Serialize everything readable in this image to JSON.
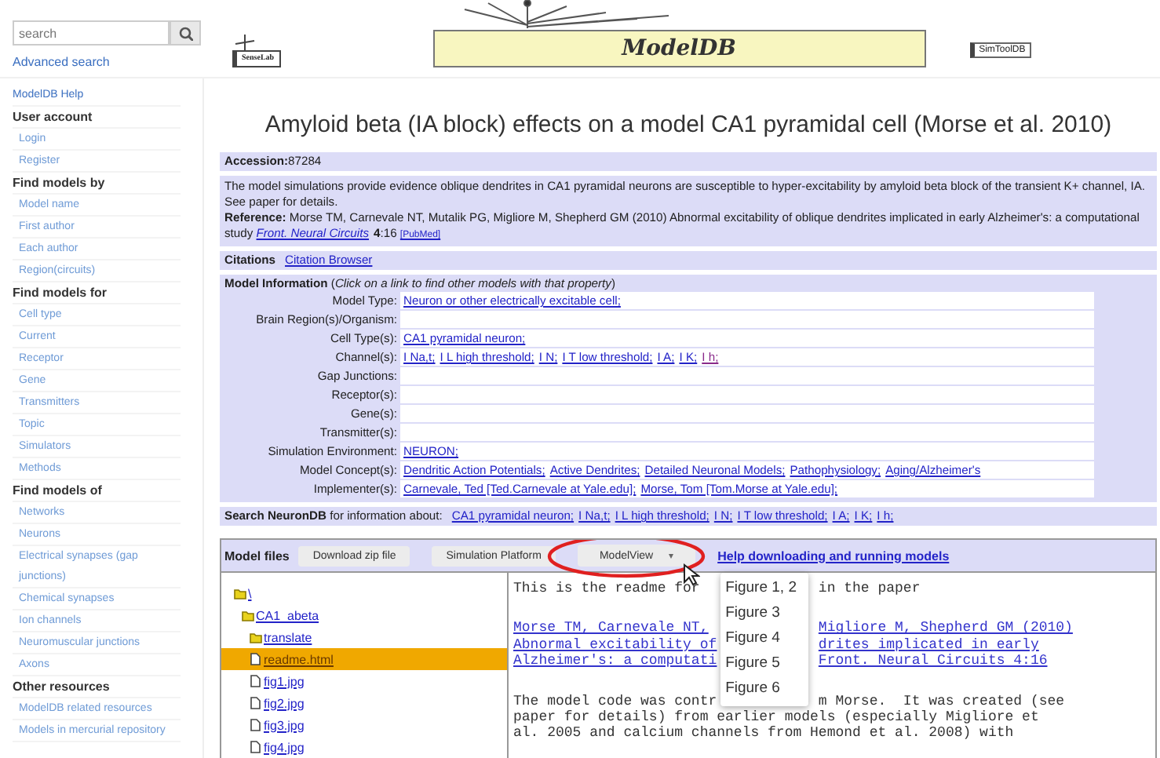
{
  "sidebar": {
    "search": {
      "placeholder": "search"
    },
    "advanced_search": "Advanced search",
    "items": [
      {
        "kind": "link",
        "label": "ModelDB Help"
      },
      {
        "kind": "heading",
        "label": "User account"
      },
      {
        "kind": "sublink",
        "label": "Login"
      },
      {
        "kind": "sublink",
        "label": "Register"
      },
      {
        "kind": "heading",
        "label": "Find models by"
      },
      {
        "kind": "sublink",
        "label": "Model name"
      },
      {
        "kind": "sublink",
        "label": "First author"
      },
      {
        "kind": "sublink",
        "label": "Each author"
      },
      {
        "kind": "sublink",
        "label": "Region(circuits)"
      },
      {
        "kind": "heading",
        "label": "Find models for"
      },
      {
        "kind": "sublink",
        "label": "Cell type"
      },
      {
        "kind": "sublink",
        "label": "Current"
      },
      {
        "kind": "sublink",
        "label": "Receptor"
      },
      {
        "kind": "sublink",
        "label": "Gene"
      },
      {
        "kind": "sublink",
        "label": "Transmitters"
      },
      {
        "kind": "sublink",
        "label": "Topic"
      },
      {
        "kind": "sublink",
        "label": "Simulators"
      },
      {
        "kind": "sublink",
        "label": "Methods"
      },
      {
        "kind": "heading",
        "label": "Find models of"
      },
      {
        "kind": "sublink",
        "label": "Networks"
      },
      {
        "kind": "sublink",
        "label": "Neurons"
      },
      {
        "kind": "sublink",
        "label": "Electrical synapses (gap junctions)"
      },
      {
        "kind": "sublink",
        "label": "Chemical synapses"
      },
      {
        "kind": "sublink",
        "label": "Ion channels"
      },
      {
        "kind": "sublink",
        "label": "Neuromuscular junctions"
      },
      {
        "kind": "sublink",
        "label": "Axons"
      },
      {
        "kind": "heading",
        "label": "Other resources"
      },
      {
        "kind": "sublink",
        "label": "ModelDB related resources"
      },
      {
        "kind": "sublink",
        "label": "Models in mercurial repository"
      }
    ]
  },
  "header": {
    "senselab": "SenseLab",
    "modeldb": "ModelDB",
    "simtooldb": "SimToolDB"
  },
  "title": "Amyloid beta (IA block) effects on a model CA1 pyramidal cell (Morse et al. 2010)",
  "accession": "**Accession:**87284",
  "description": "The model simulations provide evidence oblique dendrites in CA1 pyramidal neurons are susceptible to hyper-excitability by amyloid beta block of the transient K+ channel, IA. See paper for details.",
  "reference": {
    "text": "**Reference:** Morse TM, Carnevale NT, Mutalik PG, Migliore M, Shepherd GM (2010) Abnormal excitability of oblique dendrites implicated in early Alzheimer's: a computational study",
    "journal": "Front. Neural Circuits",
    "volume": "**4**:16",
    "pubmed": "[PubMed]"
  },
  "citations": {
    "label": "Citations",
    "link": "Citation Browser"
  },
  "model_information": {
    "heading": "**Model Information** (*Click on a link to find other models with that property*)",
    "rows": [
      {
        "label": "Model Type:",
        "links": [
          {
            "text": "Neuron or other electrically excitable cell;",
            "visited": false
          }
        ]
      },
      {
        "label": "Brain Region(s)/Organism:",
        "links": []
      },
      {
        "label": "Cell Type(s):",
        "links": [
          {
            "text": "CA1 pyramidal neuron;",
            "visited": false
          }
        ]
      },
      {
        "label": "Channel(s):",
        "links": [
          {
            "text": "I Na,t;",
            "visited": false
          },
          {
            "text": "I L high threshold;",
            "visited": false
          },
          {
            "text": "I N;",
            "visited": false
          },
          {
            "text": "I T low threshold;",
            "visited": false
          },
          {
            "text": "I A;",
            "visited": false
          },
          {
            "text": "I K;",
            "visited": false
          },
          {
            "text": "I h;",
            "visited": true
          }
        ]
      },
      {
        "label": "Gap Junctions:",
        "links": []
      },
      {
        "label": "Receptor(s):",
        "links": []
      },
      {
        "label": "Gene(s):",
        "links": []
      },
      {
        "label": "Transmitter(s):",
        "links": []
      },
      {
        "label": "Simulation Environment:",
        "links": [
          {
            "text": "NEURON;",
            "visited": false
          }
        ]
      },
      {
        "label": "Model Concept(s):",
        "links": [
          {
            "text": "Dendritic Action Potentials;",
            "visited": false
          },
          {
            "text": "Active Dendrites;",
            "visited": false
          },
          {
            "text": "Detailed Neuronal Models;",
            "visited": false
          },
          {
            "text": "Pathophysiology;",
            "visited": false
          },
          {
            "text": "Aging/Alzheimer's",
            "visited": false
          }
        ]
      },
      {
        "label": "Implementer(s):",
        "links": [
          {
            "text": "Carnevale, Ted [Ted.Carnevale at Yale.edu];",
            "visited": false
          },
          {
            "text": "Morse, Tom [Tom.Morse at Yale.edu];",
            "visited": false
          }
        ]
      }
    ]
  },
  "neurondb": {
    "text": "**Search NeuronDB** for information about:",
    "links": [
      {
        "text": "CA1 pyramidal neuron;",
        "visited": false
      },
      {
        "text": "I Na,t;",
        "visited": false
      },
      {
        "text": "I L high threshold;",
        "visited": false
      },
      {
        "text": "I N;",
        "visited": false
      },
      {
        "text": "I T low threshold;",
        "visited": false
      },
      {
        "text": "I A;",
        "visited": false
      },
      {
        "text": "I K;",
        "visited": false
      },
      {
        "text": "I h;",
        "visited": false
      }
    ]
  },
  "files": {
    "label": "Model files",
    "buttons": [
      {
        "kind": "button",
        "label": "Download zip file"
      },
      {
        "kind": "button",
        "label": "Simulation Platform"
      },
      {
        "kind": "dropdown",
        "label": "ModelView",
        "caret": "▾",
        "expanded": true,
        "options": [
          "Figure 1, 2",
          "Figure 3",
          "Figure 4",
          "Figure 5",
          "Figure 6"
        ]
      }
    ],
    "help_link": "Help downloading and running models",
    "tree": [
      {
        "kind": "folder",
        "name": "\\",
        "selected": false,
        "children": [
          {
            "kind": "folder",
            "name": "CA1_abeta",
            "selected": false,
            "children": [
              {
                "kind": "folder",
                "name": "translate",
                "selected": false
              },
              {
                "kind": "file",
                "name": "readme.html",
                "selected": true
              },
              {
                "kind": "file",
                "name": "fig1.jpg",
                "selected": false
              },
              {
                "kind": "file",
                "name": "fig2.jpg",
                "selected": false
              },
              {
                "kind": "file",
                "name": "fig3.jpg",
                "selected": false
              },
              {
                "kind": "file",
                "name": "fig4.jpg",
                "selected": false
              }
            ]
          }
        ]
      }
    ],
    "readme": [
      [
        {
          "left": "This is the readme for",
          "right": "in the paper",
          "link": false
        }
      ],
      [
        {
          "left": "Morse TM, Carnevale NT,",
          "right": "Migliore M, Shepherd GM (2010)",
          "link": true
        },
        {
          "left": "Abnormal excitability of",
          "right": "drites implicated in early",
          "link": true
        },
        {
          "left": "Alzheimer's: a computati",
          "right": "Front. Neural Circuits 4:16",
          "link": true
        }
      ],
      [
        {
          "left": "The model code was contr",
          "right": "m Morse.  It was created (see",
          "link": false
        },
        {
          "left": "paper for details) from earlier models (especially Migliore et",
          "link": false
        },
        {
          "left": "al. 2005 and calcium channels from Hemond et al. 2008) with",
          "link": false
        }
      ]
    ]
  }
}
